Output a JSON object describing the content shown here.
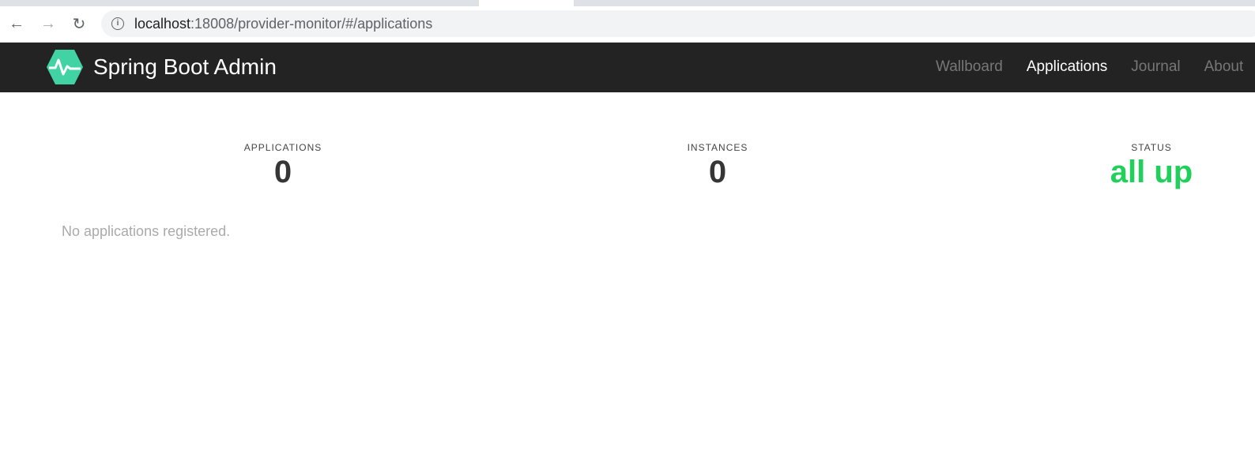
{
  "browser": {
    "url_host": "localhost",
    "url_rest": ":18008/provider-monitor/#/applications",
    "back_icon": "arrow-left",
    "forward_icon": "arrow-right",
    "reload_icon": "reload",
    "info_icon": "info-circle"
  },
  "navbar": {
    "brand": "Spring Boot Admin",
    "links": [
      {
        "label": "Wallboard",
        "active": false
      },
      {
        "label": "Applications",
        "active": true
      },
      {
        "label": "Journal",
        "active": false
      },
      {
        "label": "About",
        "active": false
      }
    ]
  },
  "summary": {
    "applications_label": "APPLICATIONS",
    "applications_value": "0",
    "instances_label": "INSTANCES",
    "instances_value": "0",
    "status_label": "STATUS",
    "status_value": "all up",
    "status_color": "#20d05a"
  },
  "empty_message": "No applications registered.",
  "colors": {
    "brand": "#42d3a5",
    "navbar": "#232323"
  }
}
